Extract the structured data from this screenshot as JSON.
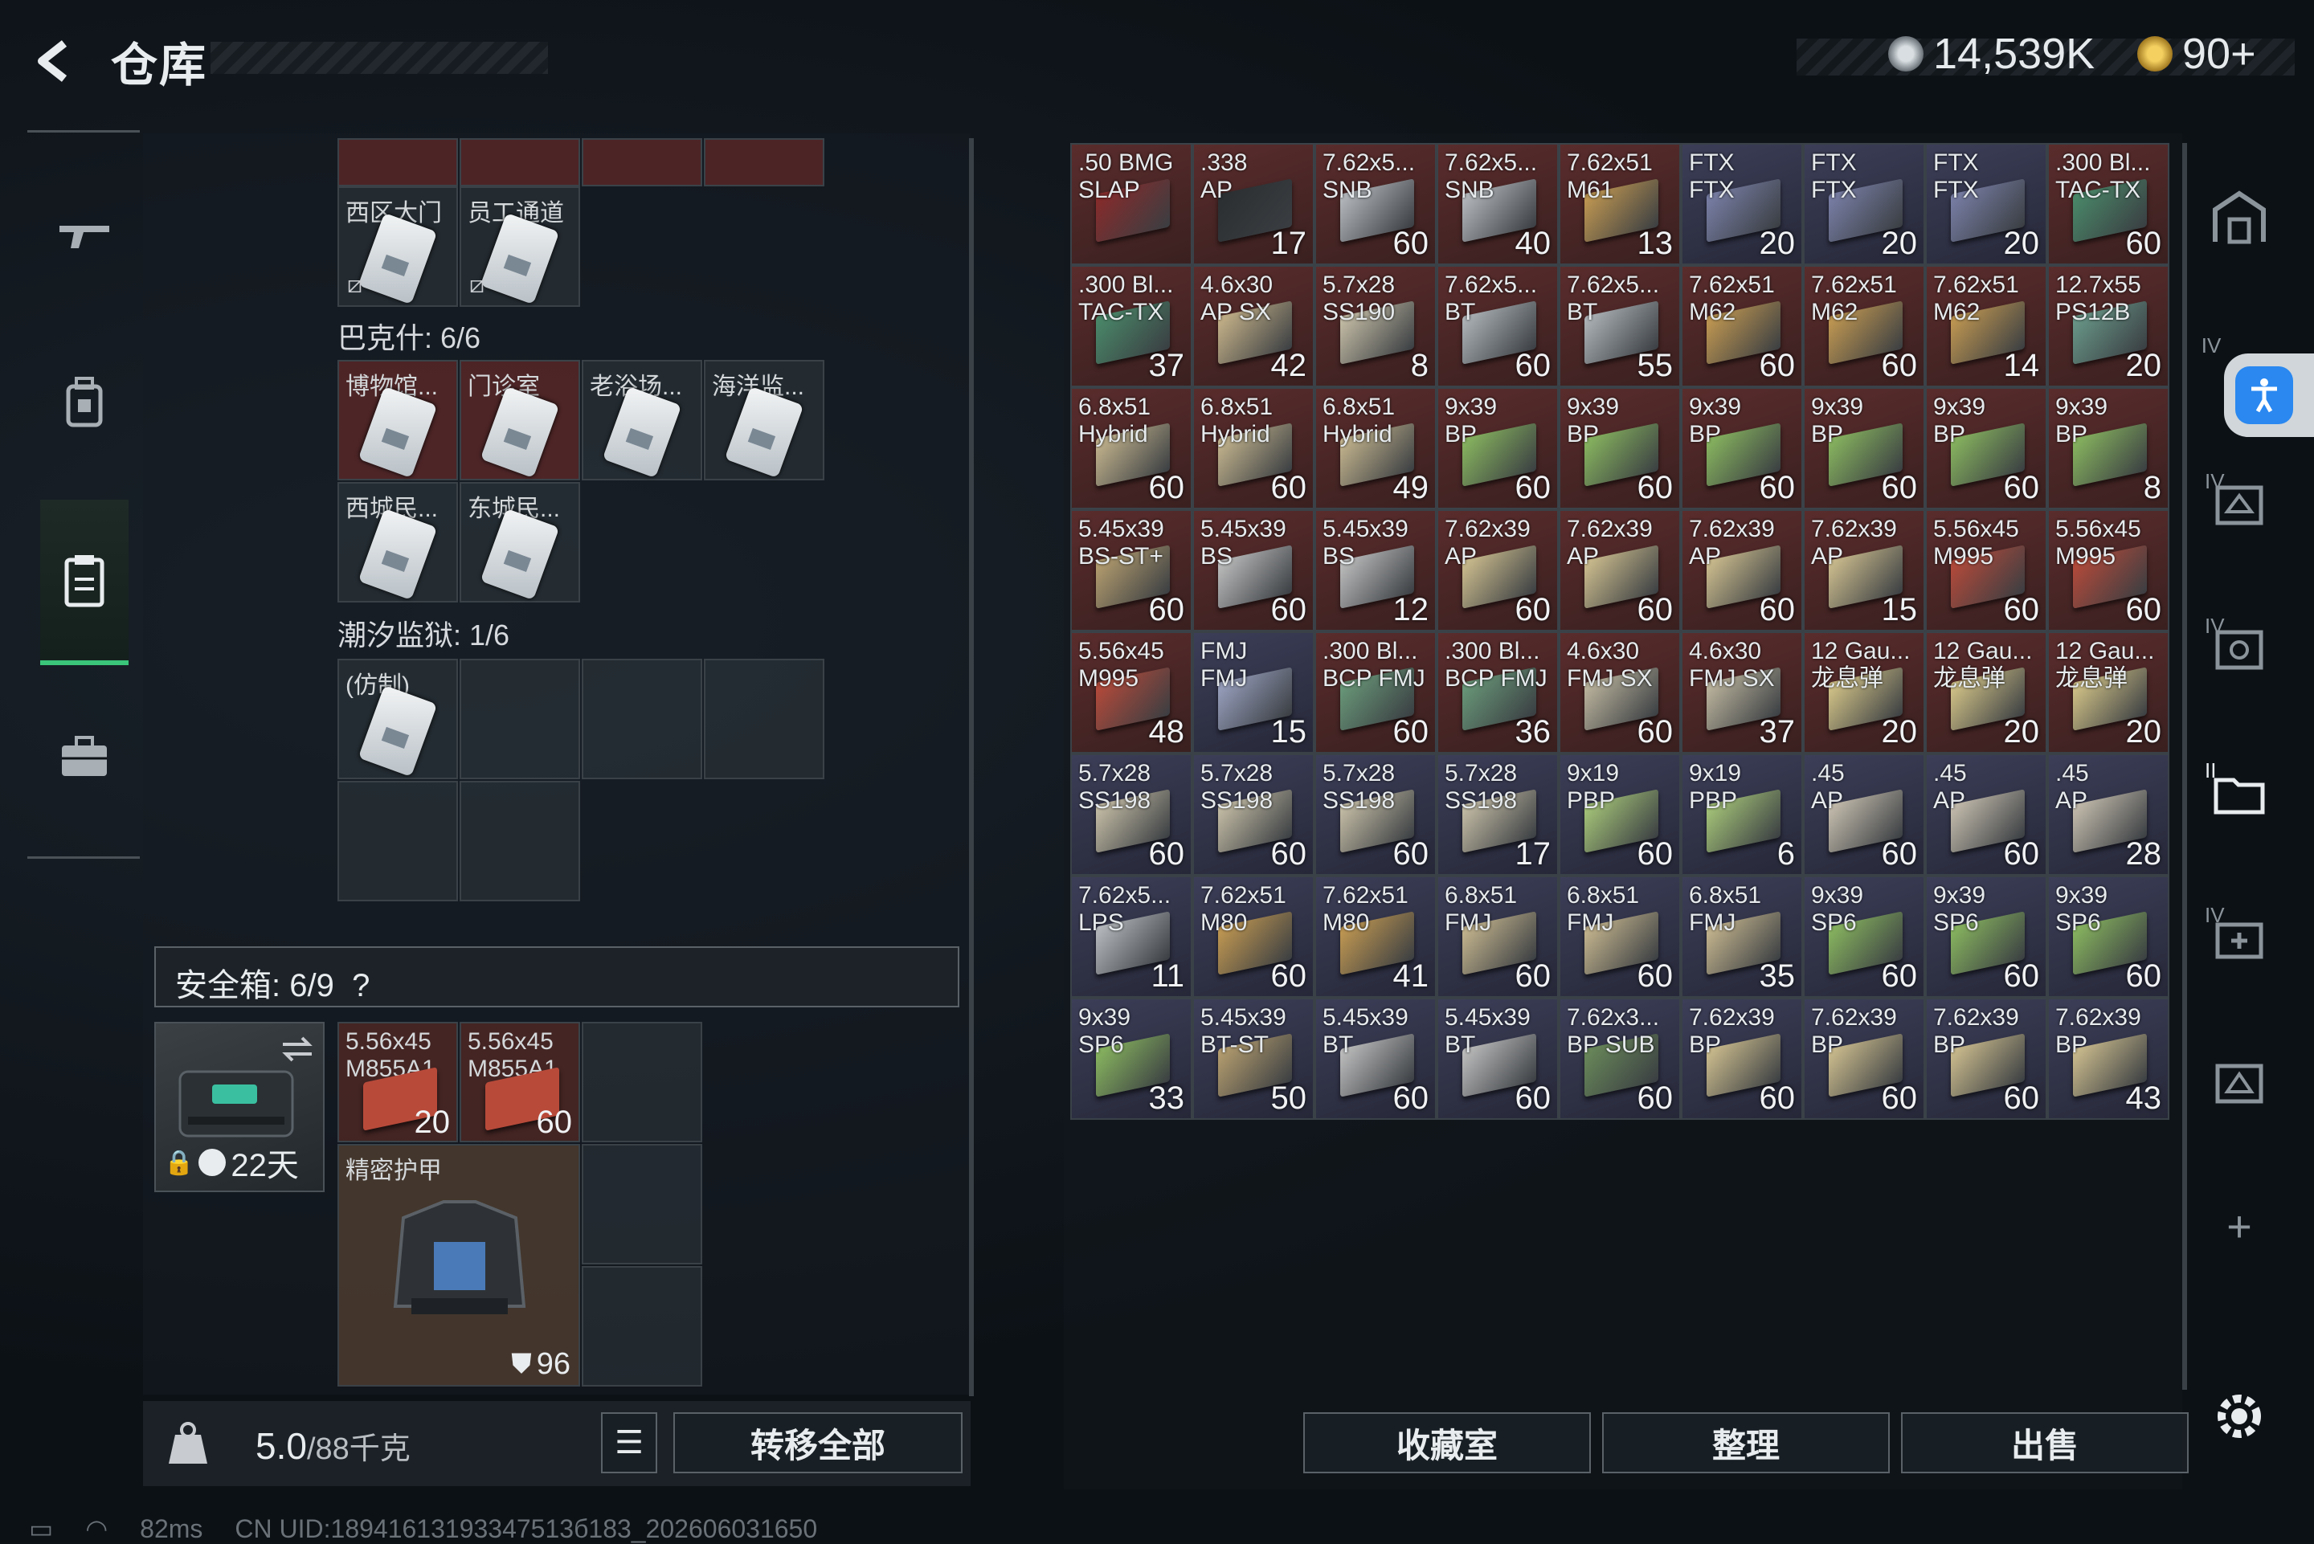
{
  "header": {
    "title": "仓库",
    "currency_main": "14,539K",
    "currency_secondary": "90+"
  },
  "stash": {
    "top_cells": [
      {
        "name": "西区大门",
        "no_icon": true
      },
      {
        "name": "员工通道",
        "no_icon": true
      }
    ],
    "group1_label": "巴克什: 6/6",
    "group1_cells": [
      {
        "name": "博物馆...",
        "red": true
      },
      {
        "name": "门诊室",
        "red": true
      },
      {
        "name": "老浴场...",
        "red": false
      },
      {
        "name": "海洋监...",
        "red": false
      },
      {
        "name": "西城民...",
        "red": false
      },
      {
        "name": "东城民...",
        "red": false
      }
    ],
    "group2_label": "潮汐监狱: 1/6",
    "group2_cells": [
      {
        "name": "(仿制)",
        "red": false
      }
    ]
  },
  "safebox": {
    "label": "安全箱: 6/9",
    "help": "?",
    "timer": "22天",
    "items": [
      {
        "name": "5.56x45\nM855A1",
        "qty": "20"
      },
      {
        "name": "5.56x45\nM855A1",
        "qty": "60"
      }
    ],
    "armor_name": "精密护甲",
    "armor_value": "96"
  },
  "weight": {
    "value": "5.0",
    "max": "/88千克",
    "transfer_all": "转移全部"
  },
  "inventory": [
    {
      "name": ".50 BMG\nSLAP",
      "qty": "",
      "color": "#8a2a2a",
      "bg": "red"
    },
    {
      "name": ".338\nAP",
      "qty": "17",
      "color": "#2a2e30",
      "bg": "red"
    },
    {
      "name": "7.62x5...\nSNB",
      "qty": "60",
      "color": "#b8bcc0",
      "bg": "red"
    },
    {
      "name": "7.62x5...\nSNB",
      "qty": "40",
      "color": "#b8bcc0",
      "bg": "red"
    },
    {
      "name": "7.62x51\nM61",
      "qty": "13",
      "color": "#c49a52",
      "bg": "red"
    },
    {
      "name": "FTX\nFTX",
      "qty": "20",
      "color": "#7a80a8",
      "bg": "purple"
    },
    {
      "name": "FTX\nFTX",
      "qty": "20",
      "color": "#7a80a8",
      "bg": "purple"
    },
    {
      "name": "FTX\nFTX",
      "qty": "20",
      "color": "#7a80a8",
      "bg": "purple"
    },
    {
      "name": ".300 Bl...\nTAC-TX",
      "qty": "60",
      "color": "#4a8a6a",
      "bg": "red"
    },
    {
      "name": ".300 Bl...\nTAC-TX",
      "qty": "37",
      "color": "#4a8a6a",
      "bg": "red"
    },
    {
      "name": "4.6x30\nAP SX",
      "qty": "42",
      "color": "#c8b48a",
      "bg": "red"
    },
    {
      "name": "5.7x28\nSS190",
      "qty": "8",
      "color": "#c8c0a8",
      "bg": "red"
    },
    {
      "name": "7.62x5...\nBT",
      "qty": "60",
      "color": "#b0b6ba",
      "bg": "red"
    },
    {
      "name": "7.62x5...\nBT",
      "qty": "55",
      "color": "#b0b6ba",
      "bg": "red"
    },
    {
      "name": "7.62x51\nM62",
      "qty": "60",
      "color": "#c49a52",
      "bg": "red"
    },
    {
      "name": "7.62x51\nM62",
      "qty": "60",
      "color": "#c49a52",
      "bg": "red"
    },
    {
      "name": "7.62x51\nM62",
      "qty": "14",
      "color": "#c49a52",
      "bg": "red"
    },
    {
      "name": "12.7x55\nPS12B",
      "qty": "20",
      "color": "#6a9a8a",
      "bg": "red"
    },
    {
      "name": "6.8x51\nHybrid",
      "qty": "60",
      "color": "#c8b890",
      "bg": "red"
    },
    {
      "name": "6.8x51\nHybrid",
      "qty": "60",
      "color": "#c8b890",
      "bg": "red"
    },
    {
      "name": "6.8x51\nHybrid",
      "qty": "49",
      "color": "#c8b890",
      "bg": "red"
    },
    {
      "name": "9x39\nBP",
      "qty": "60",
      "color": "#8ab860",
      "bg": "red"
    },
    {
      "name": "9x39\nBP",
      "qty": "60",
      "color": "#8ab860",
      "bg": "red"
    },
    {
      "name": "9x39\nBP",
      "qty": "60",
      "color": "#8ab860",
      "bg": "red"
    },
    {
      "name": "9x39\nBP",
      "qty": "60",
      "color": "#8ab860",
      "bg": "red"
    },
    {
      "name": "9x39\nBP",
      "qty": "60",
      "color": "#8ab860",
      "bg": "red"
    },
    {
      "name": "9x39\nBP",
      "qty": "8",
      "color": "#8ab860",
      "bg": "red"
    },
    {
      "name": "5.45x39\nBS-ST+",
      "qty": "60",
      "color": "#b8a070",
      "bg": "red"
    },
    {
      "name": "5.45x39\nBS",
      "qty": "60",
      "color": "#c0c0c0",
      "bg": "red"
    },
    {
      "name": "5.45x39\nBS",
      "qty": "12",
      "color": "#c0c0c0",
      "bg": "red"
    },
    {
      "name": "7.62x39\nAP",
      "qty": "60",
      "color": "#d0c090",
      "bg": "red"
    },
    {
      "name": "7.62x39\nAP",
      "qty": "60",
      "color": "#d0c090",
      "bg": "red"
    },
    {
      "name": "7.62x39\nAP",
      "qty": "60",
      "color": "#d0c090",
      "bg": "red"
    },
    {
      "name": "7.62x39\nAP",
      "qty": "15",
      "color": "#d0c090",
      "bg": "red"
    },
    {
      "name": "5.56x45\nM995",
      "qty": "60",
      "color": "#b84a3a",
      "bg": "red"
    },
    {
      "name": "5.56x45\nM995",
      "qty": "60",
      "color": "#b84a3a",
      "bg": "red"
    },
    {
      "name": "5.56x45\nM995",
      "qty": "48",
      "color": "#b84a3a",
      "bg": "red"
    },
    {
      "name": "FMJ\nFMJ",
      "qty": "15",
      "color": "#9aa2c0",
      "bg": "purple"
    },
    {
      "name": ".300 Bl...\nBCP FMJ",
      "qty": "60",
      "color": "#6a9a7a",
      "bg": "red"
    },
    {
      "name": ".300 Bl...\nBCP FMJ",
      "qty": "36",
      "color": "#6a9a7a",
      "bg": "red"
    },
    {
      "name": "4.6x30\nFMJ SX",
      "qty": "60",
      "color": "#c0b8a0",
      "bg": "red"
    },
    {
      "name": "4.6x30\nFMJ SX",
      "qty": "37",
      "color": "#c0b8a0",
      "bg": "red"
    },
    {
      "name": "12 Gau...\n龙息弹",
      "qty": "20",
      "color": "#d8c88a",
      "bg": "red"
    },
    {
      "name": "12 Gau...\n龙息弹",
      "qty": "20",
      "color": "#d8c88a",
      "bg": "red"
    },
    {
      "name": "12 Gau...\n龙息弹",
      "qty": "20",
      "color": "#d8c88a",
      "bg": "red"
    },
    {
      "name": "5.7x28\nSS198",
      "qty": "60",
      "color": "#c8c0a8",
      "bg": "purple"
    },
    {
      "name": "5.7x28\nSS198",
      "qty": "60",
      "color": "#c8c0a8",
      "bg": "purple"
    },
    {
      "name": "5.7x28\nSS198",
      "qty": "60",
      "color": "#c8c0a8",
      "bg": "purple"
    },
    {
      "name": "5.7x28\nSS198",
      "qty": "17",
      "color": "#c8c0a8",
      "bg": "purple"
    },
    {
      "name": "9x19\nPBP",
      "qty": "60",
      "color": "#a8c87a",
      "bg": "purple"
    },
    {
      "name": "9x19\nPBP",
      "qty": "6",
      "color": "#a8c87a",
      "bg": "purple"
    },
    {
      "name": ".45\nAP",
      "qty": "60",
      "color": "#c8c0b0",
      "bg": "purple"
    },
    {
      "name": ".45\nAP",
      "qty": "60",
      "color": "#c8c0b0",
      "bg": "purple"
    },
    {
      "name": ".45\nAP",
      "qty": "28",
      "color": "#c8c0b0",
      "bg": "purple"
    },
    {
      "name": "7.62x5...\nLPS",
      "qty": "11",
      "color": "#b8bcc0",
      "bg": "purple"
    },
    {
      "name": "7.62x51\nM80",
      "qty": "60",
      "color": "#c49a52",
      "bg": "purple"
    },
    {
      "name": "7.62x51\nM80",
      "qty": "41",
      "color": "#c49a52",
      "bg": "purple"
    },
    {
      "name": "6.8x51\nFMJ",
      "qty": "60",
      "color": "#c8b890",
      "bg": "purple"
    },
    {
      "name": "6.8x51\nFMJ",
      "qty": "60",
      "color": "#c8b890",
      "bg": "purple"
    },
    {
      "name": "6.8x51\nFMJ",
      "qty": "35",
      "color": "#c8b890",
      "bg": "purple"
    },
    {
      "name": "9x39\nSP6",
      "qty": "60",
      "color": "#8ab860",
      "bg": "purple"
    },
    {
      "name": "9x39\nSP6",
      "qty": "60",
      "color": "#8ab860",
      "bg": "purple"
    },
    {
      "name": "9x39\nSP6",
      "qty": "60",
      "color": "#8ab860",
      "bg": "purple"
    },
    {
      "name": "9x39\nSP6",
      "qty": "33",
      "color": "#8ab860",
      "bg": "purple"
    },
    {
      "name": "5.45x39\nBT-ST",
      "qty": "50",
      "color": "#b8a070",
      "bg": "purple"
    },
    {
      "name": "5.45x39\nBT",
      "qty": "60",
      "color": "#c0c0c0",
      "bg": "purple"
    },
    {
      "name": "5.45x39\nBT",
      "qty": "60",
      "color": "#c0c0c0",
      "bg": "purple"
    },
    {
      "name": "7.62x3...\nBP SUB",
      "qty": "60",
      "color": "#6a8a5a",
      "bg": "purple"
    },
    {
      "name": "7.62x39\nBP",
      "qty": "60",
      "color": "#d0c090",
      "bg": "purple"
    },
    {
      "name": "7.62x39\nBP",
      "qty": "60",
      "color": "#d0c090",
      "bg": "purple"
    },
    {
      "name": "7.62x39\nBP",
      "qty": "60",
      "color": "#d0c090",
      "bg": "purple"
    },
    {
      "name": "7.62x39\nBP",
      "qty": "43",
      "color": "#d0c090",
      "bg": "purple"
    }
  ],
  "bottom_buttons": {
    "collection": "收藏室",
    "sort": "整理",
    "sell": "出售"
  },
  "right_sidebar": [
    "IV",
    "IV",
    "IV",
    "II",
    "IV"
  ],
  "status": {
    "ping": "82ms",
    "uid": "CN UID:18941613193347513б183_202606031650"
  },
  "colors": {
    "accent_green": "#3ac57a",
    "rarity_red": "#6a2c2c",
    "rarity_purple": "#3a3a5a",
    "access_blue": "#2a88f0"
  }
}
